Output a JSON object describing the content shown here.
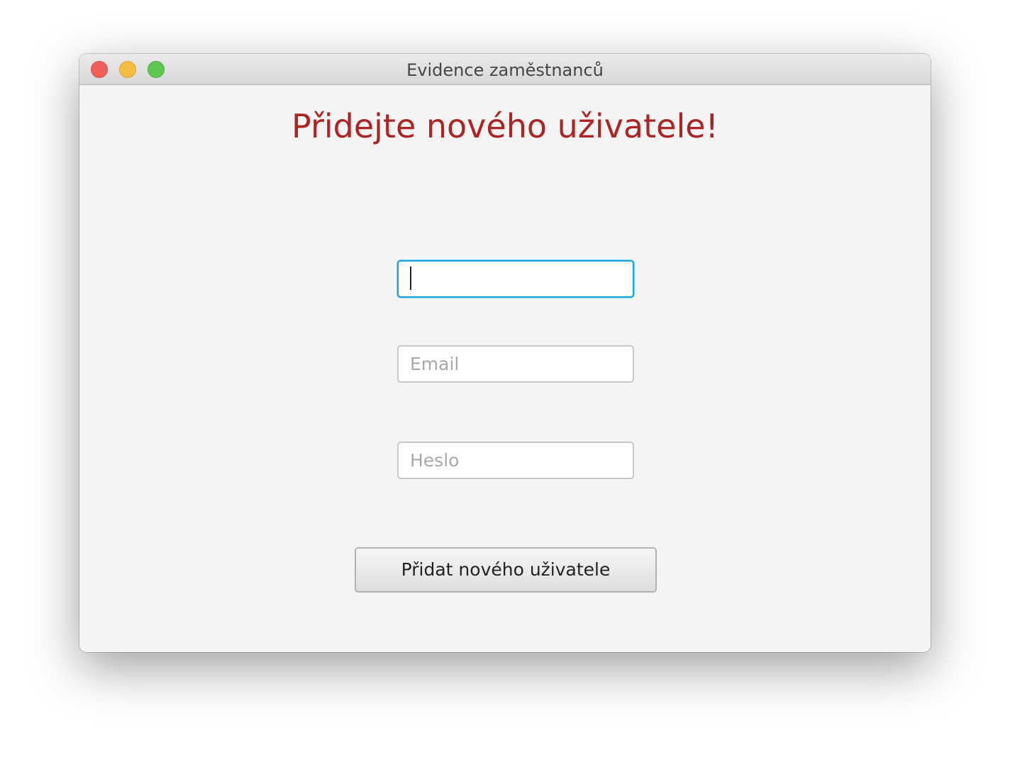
{
  "window": {
    "title": "Evidence zaměstnanců"
  },
  "form": {
    "heading": "Přidejte nového uživatele!",
    "name_field": {
      "value": "",
      "placeholder": ""
    },
    "email_field": {
      "value": "",
      "placeholder": "Email"
    },
    "password_field": {
      "value": "",
      "placeholder": "Heslo"
    },
    "submit_label": "Přidat nového uživatele"
  },
  "colors": {
    "heading": "#ac2525",
    "focus_ring": "#15a3e3",
    "close": "#f0605a",
    "minimize": "#f6bd45",
    "maximize": "#5fc751"
  }
}
